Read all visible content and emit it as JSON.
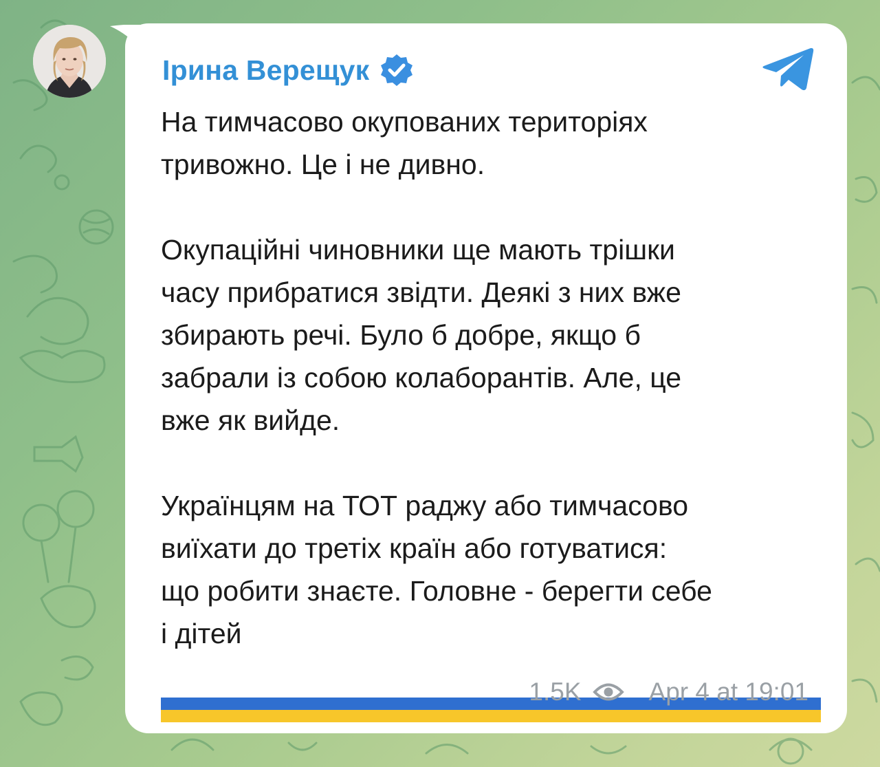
{
  "post": {
    "author_name": "Ірина Верещук",
    "verified": true,
    "paragraphs": [
      "На тимчасово окупованих територіях\nтривожно. Це і не дивно.",
      "Окупаційні чиновники ще мають трішки\nчасу прибратися звідти. Деякі з них вже\nзбирають речі. Було б добре, якщо б\nзабрали із собою колаборантів. Але, це\nвже як вийде.",
      "Українцям на ТОТ раджу або тимчасово\nвиїхати до третіх країн або готуватися:\nщо робити знаєте. Головне - берегти себе\nі дітей"
    ],
    "trailing_emoji": "ukraine-flag",
    "views": "1.5K",
    "timestamp": "Apr 4 at 19:01"
  },
  "icons": {
    "verified": "verified-badge-icon",
    "app": "telegram-icon",
    "views": "eye-icon"
  },
  "colors": {
    "author": "#3390d6",
    "text": "#1b1b1b",
    "meta": "#9aa0a5",
    "bubble": "#ffffff",
    "flag_blue": "#2f6fd0",
    "flag_yellow": "#f7c62a"
  }
}
